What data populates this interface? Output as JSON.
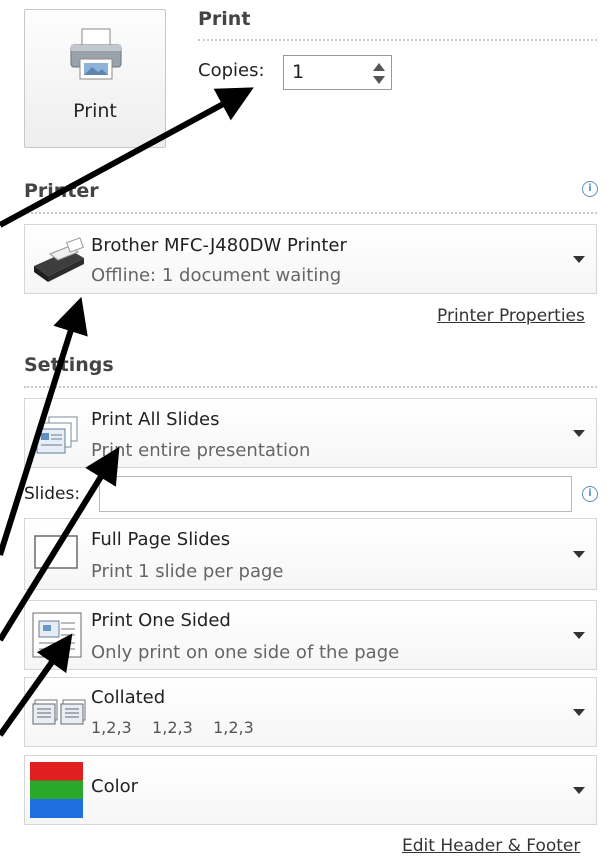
{
  "print_button": {
    "label": "Print",
    "icon": "printer-icon"
  },
  "print_section": {
    "title": "Print",
    "copies_label": "Copies:",
    "copies_value": "1"
  },
  "printer_section": {
    "title": "Printer",
    "name": "Brother MFC-J480DW Printer",
    "status": "Offline: 1 document waiting",
    "properties_link": "Printer Properties"
  },
  "settings_section": {
    "title": "Settings",
    "slides_label": "Slides:",
    "slides_value": "",
    "options": [
      {
        "title": "Print All Slides",
        "subtitle": "Print entire presentation",
        "icon": "slides-stack-icon"
      },
      {
        "title": "Full Page Slides",
        "subtitle": "Print 1 slide per page",
        "icon": "full-page-slide-icon"
      },
      {
        "title": "Print One Sided",
        "subtitle": "Only print on one side of the page",
        "icon": "one-sided-page-icon"
      },
      {
        "title": "Collated",
        "subtitle": "1,2,3    1,2,3    1,2,3",
        "icon": "collated-pages-icon"
      },
      {
        "title": "Color",
        "subtitle": "",
        "icon": "color-swatch-icon"
      }
    ],
    "header_footer_link": "Edit Header & Footer"
  },
  "colors": {
    "info": "#5b8ecb",
    "annotation_arrow": "#000000",
    "dotted_rule": "#c8c8c8"
  }
}
